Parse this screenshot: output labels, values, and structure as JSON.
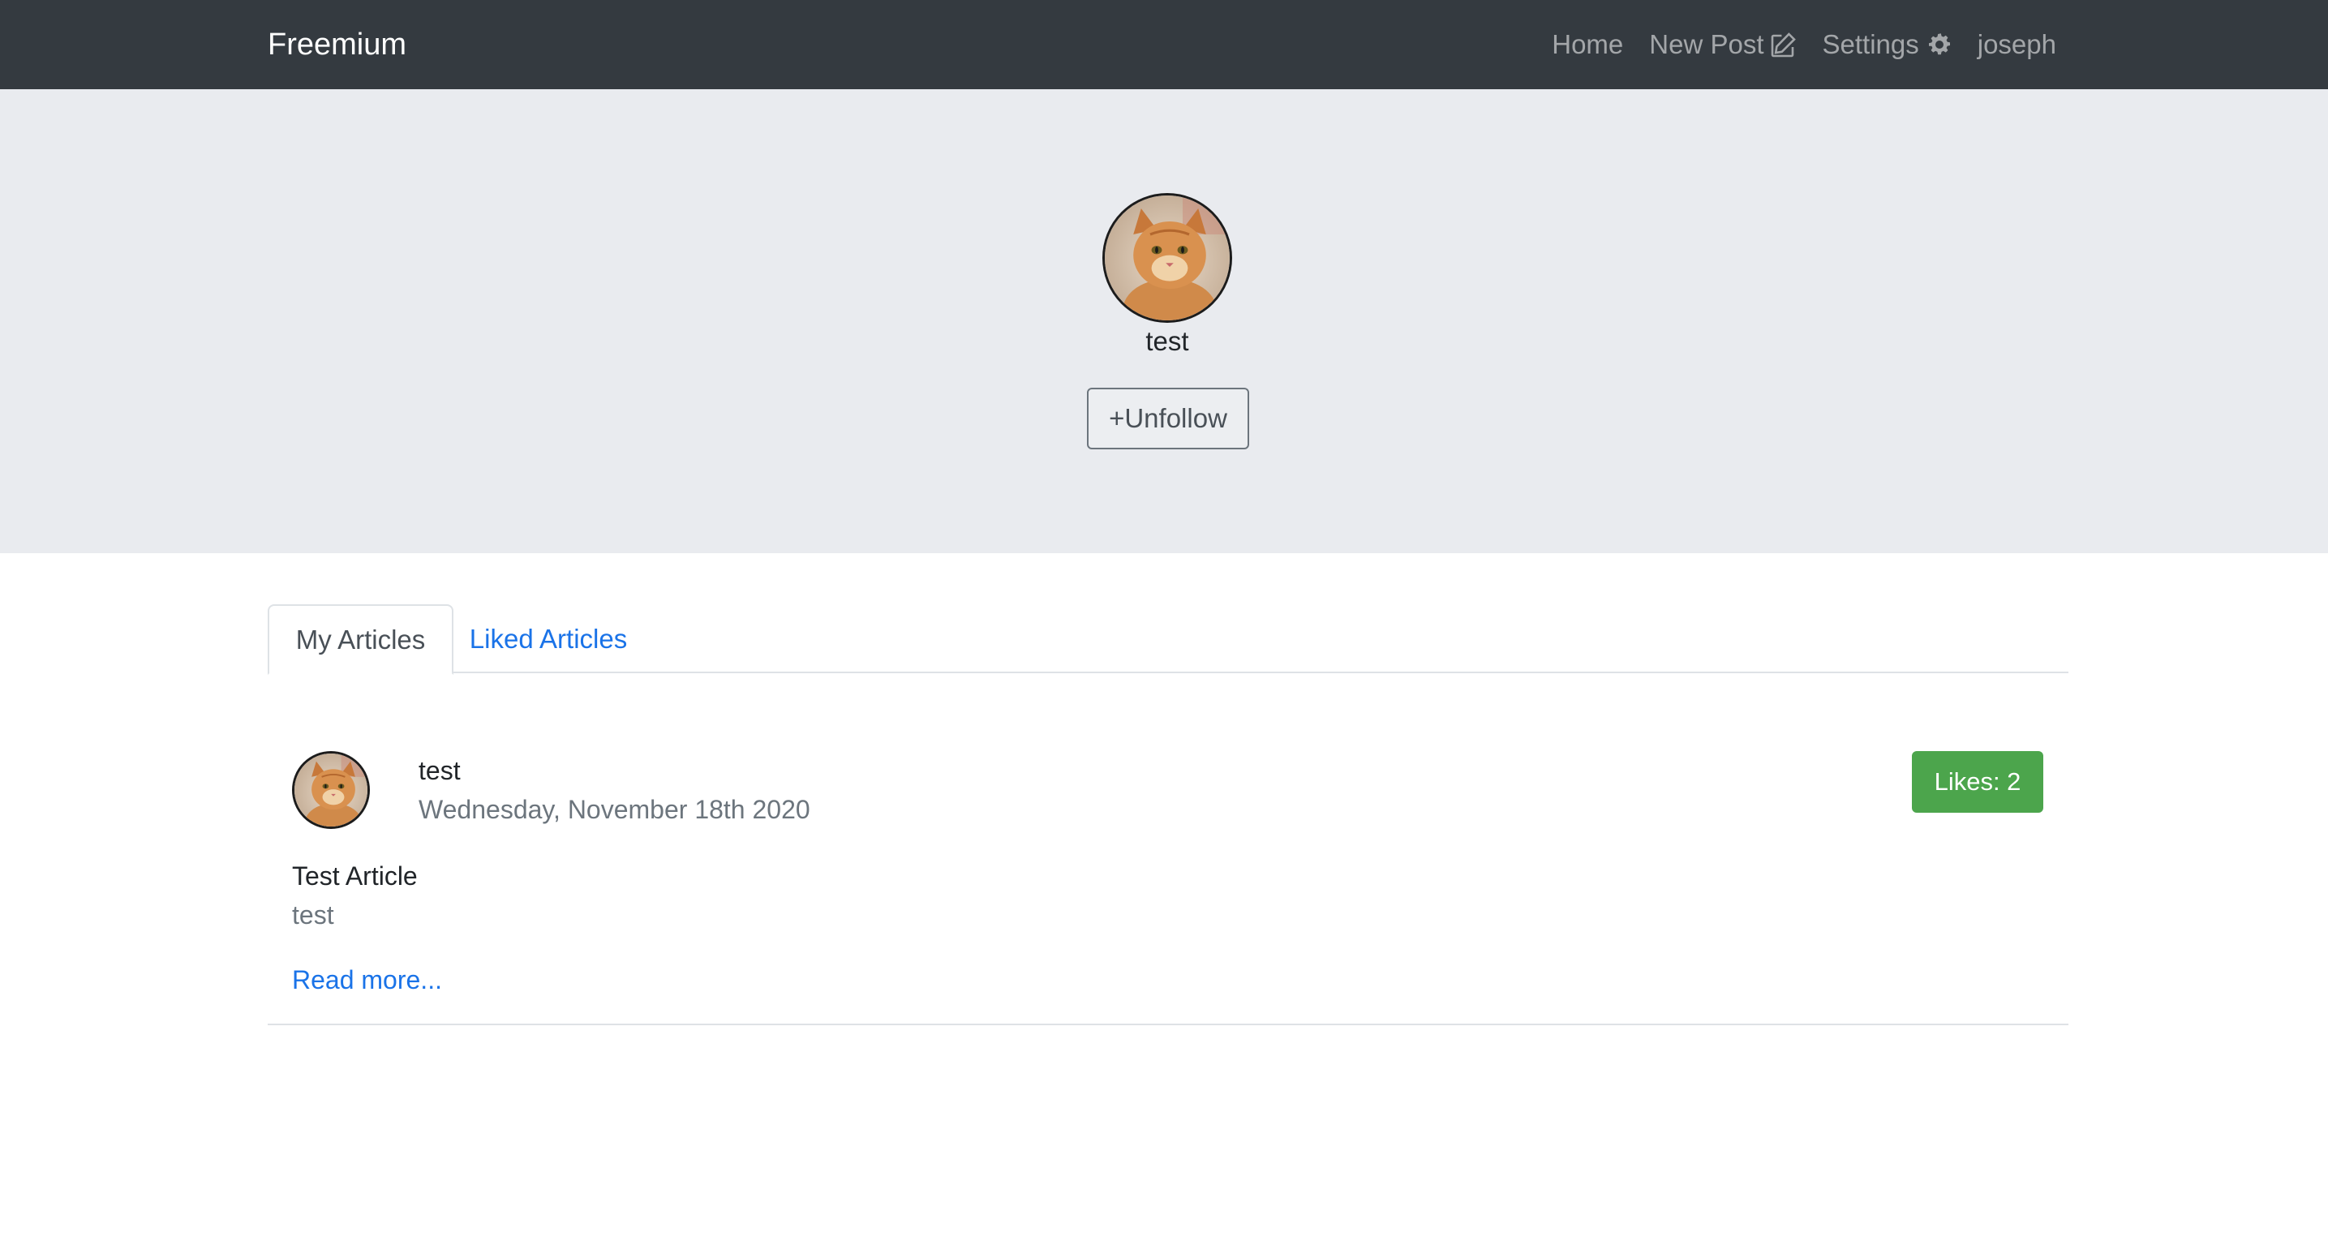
{
  "navbar": {
    "brand": "Freemium",
    "links": {
      "home": "Home",
      "new_post": "New Post",
      "settings": "Settings",
      "user": "joseph"
    },
    "icons": {
      "new_post": "edit-icon",
      "settings": "gear-icon"
    }
  },
  "profile": {
    "avatar": "cat-avatar",
    "username": "test",
    "follow_button": "+Unfollow"
  },
  "tabs": {
    "items": [
      "My Articles",
      "Liked Articles"
    ],
    "active": "My Articles"
  },
  "articles": [
    {
      "avatar": "cat-avatar",
      "author": "test",
      "date": "Wednesday, November 18th 2020",
      "likes": "Likes: 2",
      "title": "Test Article",
      "description": "test",
      "read_more": "Read more..."
    }
  ],
  "colors": {
    "navbar_bg": "#343a40",
    "header_bg": "#e9ebef",
    "link_blue": "#1a73e8",
    "likes_green": "#4ca54c"
  }
}
